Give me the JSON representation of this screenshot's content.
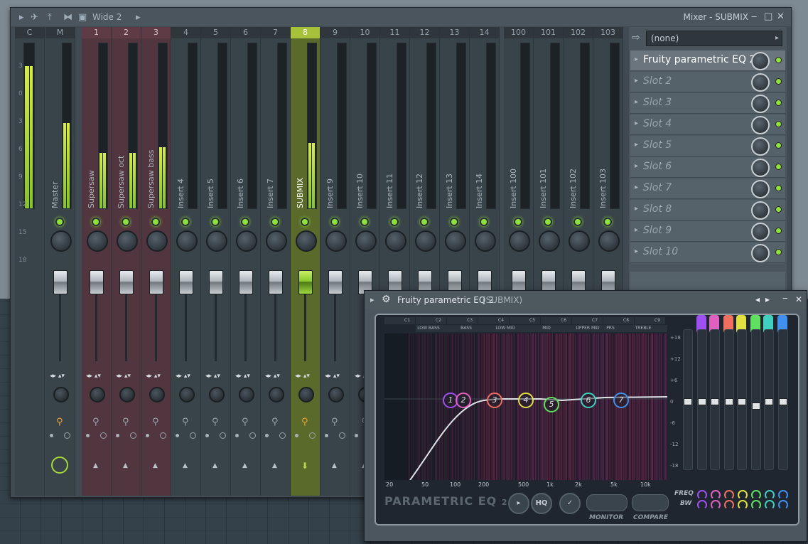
{
  "mixer": {
    "preset": "Wide 2",
    "title": "Mixer - SUBMIX",
    "channels": [
      {
        "num": "C",
        "name": ""
      },
      {
        "num": "M",
        "name": "Master"
      },
      {
        "num": "1",
        "name": "Supersaw"
      },
      {
        "num": "2",
        "name": "Supersaw oct"
      },
      {
        "num": "3",
        "name": "Supersaw bass"
      },
      {
        "num": "4",
        "name": "Insert 4"
      },
      {
        "num": "5",
        "name": "Insert 5"
      },
      {
        "num": "6",
        "name": "Insert 6"
      },
      {
        "num": "7",
        "name": "Insert 7"
      },
      {
        "num": "8",
        "name": "SUBMIX"
      },
      {
        "num": "9",
        "name": "Insert 9"
      },
      {
        "num": "10",
        "name": "Insert 10"
      },
      {
        "num": "11",
        "name": "Insert 11"
      },
      {
        "num": "12",
        "name": "Insert 12"
      },
      {
        "num": "13",
        "name": "Insert 13"
      },
      {
        "num": "14",
        "name": "Insert 14"
      },
      {
        "num": "100",
        "name": "Insert 100"
      },
      {
        "num": "101",
        "name": "Insert 101"
      },
      {
        "num": "102",
        "name": "Insert 102"
      },
      {
        "num": "103",
        "name": "Insert 103"
      }
    ],
    "scale": [
      "3",
      "0",
      "3",
      "6",
      "9",
      "12",
      "15",
      "18"
    ],
    "input": "(none)",
    "slots": [
      "Fruity parametric EQ 2",
      "Slot 2",
      "Slot 3",
      "Slot 4",
      "Slot 5",
      "Slot 6",
      "Slot 7",
      "Slot 8",
      "Slot 9",
      "Slot 10"
    ]
  },
  "eq": {
    "title": "Fruity parametric EQ 2",
    "subtitle": "(SUBMIX)",
    "notes": [
      "C1",
      "C2",
      "C3",
      "C4",
      "C5",
      "C6",
      "C7",
      "C8",
      "C9"
    ],
    "ranges": [
      "LOW BASS",
      "BASS",
      "LOW MID",
      "MID",
      "UPPER MID",
      "PRS",
      "TREBLE"
    ],
    "hz_labels": [
      "20",
      "50",
      "100",
      "200",
      "500",
      "1k",
      "2k",
      "5k",
      "10k"
    ],
    "db_labels": [
      "+18",
      "+12",
      "+6",
      "0",
      "-6",
      "-12",
      "-18"
    ],
    "bands": [
      "1",
      "2",
      "3",
      "4",
      "5",
      "6",
      "7"
    ],
    "brand": "PARAMETRIC EQ",
    "brand_num": "2",
    "hq": "HQ",
    "monitor": "MONITOR",
    "compare": "COMPARE",
    "freq_label": "FREQ",
    "bw_label": "BW",
    "colors": [
      "#a050f0",
      "#e060c0",
      "#f07060",
      "#e0e040",
      "#60e060",
      "#40d0c0",
      "#4090f0"
    ]
  }
}
